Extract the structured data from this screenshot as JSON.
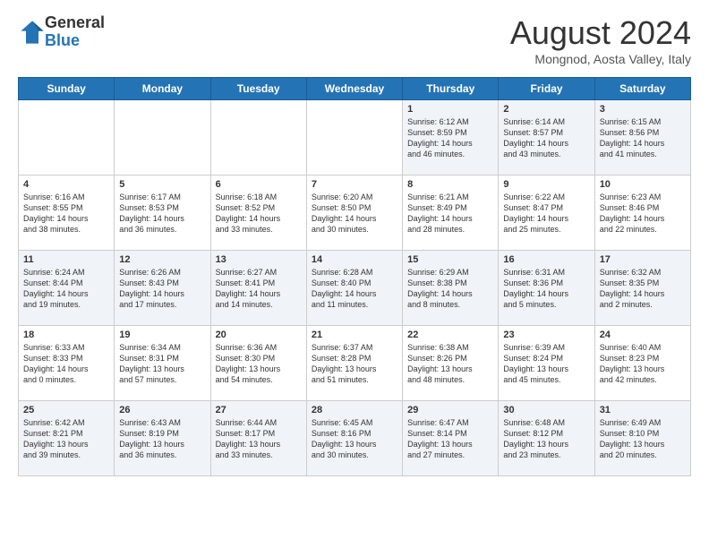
{
  "header": {
    "logo_general": "General",
    "logo_blue": "Blue",
    "month_title": "August 2024",
    "location": "Mongnod, Aosta Valley, Italy"
  },
  "days_of_week": [
    "Sunday",
    "Monday",
    "Tuesday",
    "Wednesday",
    "Thursday",
    "Friday",
    "Saturday"
  ],
  "weeks": [
    [
      {
        "num": "",
        "text": ""
      },
      {
        "num": "",
        "text": ""
      },
      {
        "num": "",
        "text": ""
      },
      {
        "num": "",
        "text": ""
      },
      {
        "num": "1",
        "text": "Sunrise: 6:12 AM\nSunset: 8:59 PM\nDaylight: 14 hours\nand 46 minutes."
      },
      {
        "num": "2",
        "text": "Sunrise: 6:14 AM\nSunset: 8:57 PM\nDaylight: 14 hours\nand 43 minutes."
      },
      {
        "num": "3",
        "text": "Sunrise: 6:15 AM\nSunset: 8:56 PM\nDaylight: 14 hours\nand 41 minutes."
      }
    ],
    [
      {
        "num": "4",
        "text": "Sunrise: 6:16 AM\nSunset: 8:55 PM\nDaylight: 14 hours\nand 38 minutes."
      },
      {
        "num": "5",
        "text": "Sunrise: 6:17 AM\nSunset: 8:53 PM\nDaylight: 14 hours\nand 36 minutes."
      },
      {
        "num": "6",
        "text": "Sunrise: 6:18 AM\nSunset: 8:52 PM\nDaylight: 14 hours\nand 33 minutes."
      },
      {
        "num": "7",
        "text": "Sunrise: 6:20 AM\nSunset: 8:50 PM\nDaylight: 14 hours\nand 30 minutes."
      },
      {
        "num": "8",
        "text": "Sunrise: 6:21 AM\nSunset: 8:49 PM\nDaylight: 14 hours\nand 28 minutes."
      },
      {
        "num": "9",
        "text": "Sunrise: 6:22 AM\nSunset: 8:47 PM\nDaylight: 14 hours\nand 25 minutes."
      },
      {
        "num": "10",
        "text": "Sunrise: 6:23 AM\nSunset: 8:46 PM\nDaylight: 14 hours\nand 22 minutes."
      }
    ],
    [
      {
        "num": "11",
        "text": "Sunrise: 6:24 AM\nSunset: 8:44 PM\nDaylight: 14 hours\nand 19 minutes."
      },
      {
        "num": "12",
        "text": "Sunrise: 6:26 AM\nSunset: 8:43 PM\nDaylight: 14 hours\nand 17 minutes."
      },
      {
        "num": "13",
        "text": "Sunrise: 6:27 AM\nSunset: 8:41 PM\nDaylight: 14 hours\nand 14 minutes."
      },
      {
        "num": "14",
        "text": "Sunrise: 6:28 AM\nSunset: 8:40 PM\nDaylight: 14 hours\nand 11 minutes."
      },
      {
        "num": "15",
        "text": "Sunrise: 6:29 AM\nSunset: 8:38 PM\nDaylight: 14 hours\nand 8 minutes."
      },
      {
        "num": "16",
        "text": "Sunrise: 6:31 AM\nSunset: 8:36 PM\nDaylight: 14 hours\nand 5 minutes."
      },
      {
        "num": "17",
        "text": "Sunrise: 6:32 AM\nSunset: 8:35 PM\nDaylight: 14 hours\nand 2 minutes."
      }
    ],
    [
      {
        "num": "18",
        "text": "Sunrise: 6:33 AM\nSunset: 8:33 PM\nDaylight: 14 hours\nand 0 minutes."
      },
      {
        "num": "19",
        "text": "Sunrise: 6:34 AM\nSunset: 8:31 PM\nDaylight: 13 hours\nand 57 minutes."
      },
      {
        "num": "20",
        "text": "Sunrise: 6:36 AM\nSunset: 8:30 PM\nDaylight: 13 hours\nand 54 minutes."
      },
      {
        "num": "21",
        "text": "Sunrise: 6:37 AM\nSunset: 8:28 PM\nDaylight: 13 hours\nand 51 minutes."
      },
      {
        "num": "22",
        "text": "Sunrise: 6:38 AM\nSunset: 8:26 PM\nDaylight: 13 hours\nand 48 minutes."
      },
      {
        "num": "23",
        "text": "Sunrise: 6:39 AM\nSunset: 8:24 PM\nDaylight: 13 hours\nand 45 minutes."
      },
      {
        "num": "24",
        "text": "Sunrise: 6:40 AM\nSunset: 8:23 PM\nDaylight: 13 hours\nand 42 minutes."
      }
    ],
    [
      {
        "num": "25",
        "text": "Sunrise: 6:42 AM\nSunset: 8:21 PM\nDaylight: 13 hours\nand 39 minutes."
      },
      {
        "num": "26",
        "text": "Sunrise: 6:43 AM\nSunset: 8:19 PM\nDaylight: 13 hours\nand 36 minutes."
      },
      {
        "num": "27",
        "text": "Sunrise: 6:44 AM\nSunset: 8:17 PM\nDaylight: 13 hours\nand 33 minutes."
      },
      {
        "num": "28",
        "text": "Sunrise: 6:45 AM\nSunset: 8:16 PM\nDaylight: 13 hours\nand 30 minutes."
      },
      {
        "num": "29",
        "text": "Sunrise: 6:47 AM\nSunset: 8:14 PM\nDaylight: 13 hours\nand 27 minutes."
      },
      {
        "num": "30",
        "text": "Sunrise: 6:48 AM\nSunset: 8:12 PM\nDaylight: 13 hours\nand 23 minutes."
      },
      {
        "num": "31",
        "text": "Sunrise: 6:49 AM\nSunset: 8:10 PM\nDaylight: 13 hours\nand 20 minutes."
      }
    ]
  ]
}
